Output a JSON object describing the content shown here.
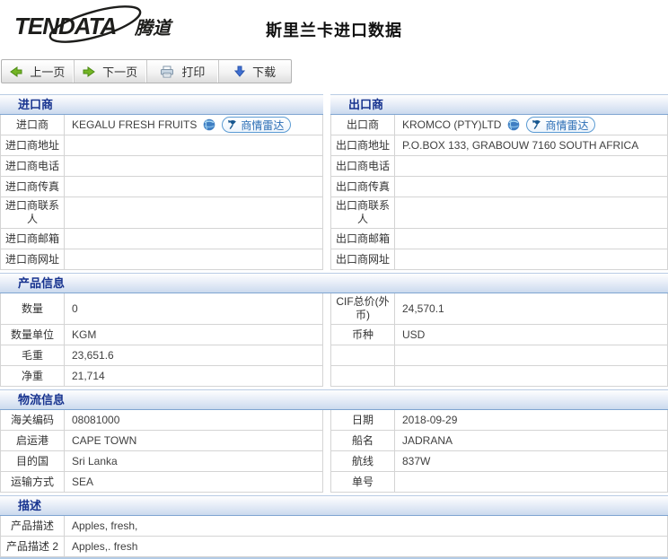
{
  "page": {
    "logo_text": "TENDATA",
    "logo_suffix": "腾道",
    "title": "斯里兰卡进口数据"
  },
  "toolbar": {
    "prev_label": "上一页",
    "next_label": "下一页",
    "print_label": "打印",
    "download_label": "下载"
  },
  "radar_label": "商情雷达",
  "colors": {
    "section_header_text": "#17338f",
    "section_header_bg_bottom": "#cbdaee",
    "radar_blue": "#2a6db5",
    "arrow_green": "#74b525",
    "arrow_blue": "#3f6fd1",
    "cell_border": "#d4d4d4"
  },
  "icons": {
    "logo_swoosh": "ellipse-swoosh",
    "prev": "arrow-left-icon",
    "next": "arrow-right-icon",
    "print": "printer-icon",
    "download": "arrow-down-icon",
    "company": "globe-icon",
    "radar": "satellite-dish-icon"
  },
  "sections": [
    {
      "headers": [
        "进口商",
        "出口商"
      ],
      "rows": [
        {
          "cells": [
            {
              "label": "进口商",
              "value": "KEGALU FRESH FRUITS",
              "company": true
            },
            {
              "label": "出口商",
              "value": "KROMCO (PTY)LTD",
              "company": true
            }
          ]
        },
        {
          "cells": [
            {
              "label": "进口商地址",
              "value": ""
            },
            {
              "label": "出口商地址",
              "value": "P.O.BOX 133, GRABOUW 7160 SOUTH AFRICA"
            }
          ]
        },
        {
          "cells": [
            {
              "label": "进口商电话",
              "value": ""
            },
            {
              "label": "出口商电话",
              "value": ""
            }
          ]
        },
        {
          "cells": [
            {
              "label": "进口商传真",
              "value": ""
            },
            {
              "label": "出口商传真",
              "value": ""
            }
          ]
        },
        {
          "tall": true,
          "cells": [
            {
              "label": "进口商联系人",
              "value": ""
            },
            {
              "label": "出口商联系人",
              "value": ""
            }
          ]
        },
        {
          "cells": [
            {
              "label": "进口商邮箱",
              "value": ""
            },
            {
              "label": "出口商邮箱",
              "value": ""
            }
          ]
        },
        {
          "cells": [
            {
              "label": "进口商网址",
              "value": ""
            },
            {
              "label": "出口商网址",
              "value": ""
            }
          ]
        }
      ]
    },
    {
      "header": "产品信息",
      "rows": [
        {
          "tall": true,
          "cells": [
            {
              "label": "数量",
              "value": "0"
            },
            {
              "label": "CIF总价(外币)",
              "value": "24,570.1"
            }
          ]
        },
        {
          "cells": [
            {
              "label": "数量单位",
              "value": "KGM"
            },
            {
              "label": "币种",
              "value": "USD"
            }
          ]
        },
        {
          "cells": [
            {
              "label": "毛重",
              "value": "23,651.6"
            },
            {
              "label": "",
              "value": ""
            }
          ]
        },
        {
          "cells": [
            {
              "label": "净重",
              "value": "21,714"
            },
            {
              "label": "",
              "value": ""
            }
          ]
        }
      ]
    },
    {
      "header": "物流信息",
      "rows": [
        {
          "cells": [
            {
              "label": "海关编码",
              "value": "08081000"
            },
            {
              "label": "日期",
              "value": "2018-09-29"
            }
          ]
        },
        {
          "cells": [
            {
              "label": "启运港",
              "value": "CAPE TOWN"
            },
            {
              "label": "船名",
              "value": "JADRANA"
            }
          ]
        },
        {
          "cells": [
            {
              "label": "目的国",
              "value": "Sri Lanka"
            },
            {
              "label": "航线",
              "value": "837W"
            }
          ]
        },
        {
          "cells": [
            {
              "label": "运输方式",
              "value": "SEA"
            },
            {
              "label": "单号",
              "value": ""
            }
          ]
        }
      ]
    },
    {
      "header": "描述",
      "rows": [
        {
          "cells": [
            {
              "label": "产品描述",
              "value": "Apples, fresh,"
            }
          ]
        },
        {
          "cells": [
            {
              "label": "产品描述 2",
              "value": "Apples,. fresh"
            }
          ]
        }
      ]
    }
  ]
}
